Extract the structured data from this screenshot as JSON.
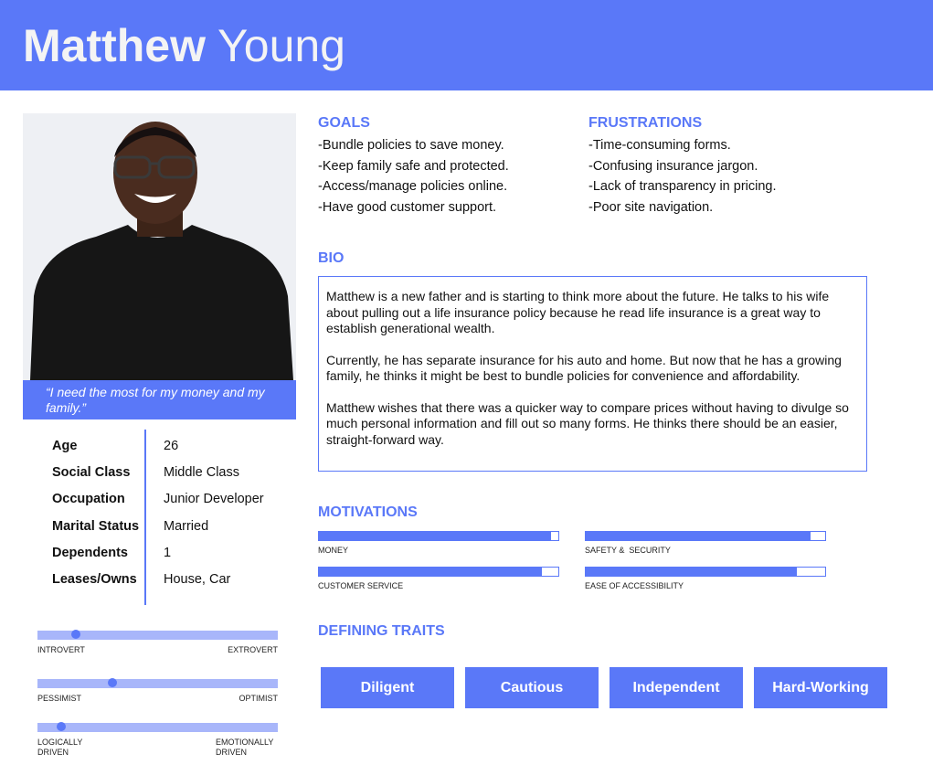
{
  "persona": {
    "first_name": "Matthew",
    "last_name": "Young"
  },
  "quote": "“I need the most for my money and my family.”",
  "facts": [
    {
      "label": "Age",
      "value": "26"
    },
    {
      "label": "Social Class",
      "value": "Middle Class"
    },
    {
      "label": "Occupation",
      "value": "Junior Developer"
    },
    {
      "label": "Marital Status",
      "value": "Married"
    },
    {
      "label": "Dependents",
      "value": "1"
    },
    {
      "label": "Leases/Owns",
      "value": "House, Car"
    }
  ],
  "scales": [
    {
      "left": "INTROVERT",
      "right": "EXTROVERT",
      "position": 0.16
    },
    {
      "left": "PESSIMIST",
      "right": "OPTIMIST",
      "position": 0.31
    },
    {
      "left": "LOGICALLY\nDRIVEN",
      "right": "EMOTIONALLY\nDRIVEN",
      "position": 0.1
    }
  ],
  "goals": {
    "title": "GOALS",
    "items": [
      "-Bundle policies to save money.",
      "-Keep family safe and protected.",
      "-Access/manage policies online.",
      "-Have good customer support."
    ]
  },
  "frustrations": {
    "title": "FRUSTRATIONS",
    "items": [
      "-Time-consuming forms.",
      "-Confusing insurance jargon.",
      "-Lack of transparency in pricing.",
      "-Poor site navigation."
    ]
  },
  "bio": {
    "title": "BIO",
    "paragraphs": [
      "Matthew is a new father and is starting to think more about the future. He talks to his wife about pulling out a life insurance policy because he read life insurance is a great way to establish generational wealth.",
      "Currently, he has separate insurance for his auto and home. But now that he has a growing family, he thinks it might be best to bundle policies for convenience and affordability.",
      "Matthew wishes that there was a quicker way to compare prices without having to divulge so much personal information and fill out so many forms. He thinks there should be an easier, straight-forward way."
    ]
  },
  "motivations": {
    "title": "MOTIVATIONS",
    "items": [
      {
        "label": "MONEY",
        "level": 0.97
      },
      {
        "label": "SAFETY &  SECURITY",
        "level": 0.94
      },
      {
        "label": "CUSTOMER SERVICE",
        "level": 0.93
      },
      {
        "label": "EASE OF ACCESSIBILITY",
        "level": 0.88
      }
    ]
  },
  "traits": {
    "title": "DEFINING TRAITS",
    "items": [
      "Diligent",
      "Cautious",
      "Independent",
      "Hard-Working"
    ]
  },
  "colors": {
    "accent": "#5a78f8",
    "accent_light": "#a8b6fa"
  }
}
